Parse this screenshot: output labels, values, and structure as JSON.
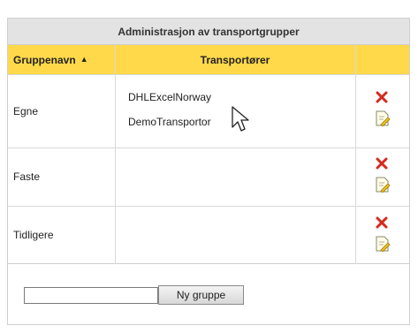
{
  "panel": {
    "title": "Administrasjon av transportgrupper"
  },
  "table": {
    "headers": {
      "group_name": "Gruppenavn",
      "sort_indicator": "▲",
      "carriers": "Transportører",
      "actions": ""
    },
    "rows": [
      {
        "name": "Egne",
        "carriers": [
          "DHLExcelNorway",
          "DemoTransportor"
        ]
      },
      {
        "name": "Faste",
        "carriers": []
      },
      {
        "name": "Tidligere",
        "carriers": []
      }
    ]
  },
  "new_group": {
    "input_value": "",
    "button_label": "Ny gruppe"
  },
  "icons": {
    "delete": "delete-x-icon",
    "edit": "edit-document-pencil-icon",
    "cursor": "mouse-pointer-icon"
  },
  "colors": {
    "header_yellow": "#ffd94a",
    "title_gray": "#e3e3e3",
    "delete_red": "#d42a1e"
  }
}
